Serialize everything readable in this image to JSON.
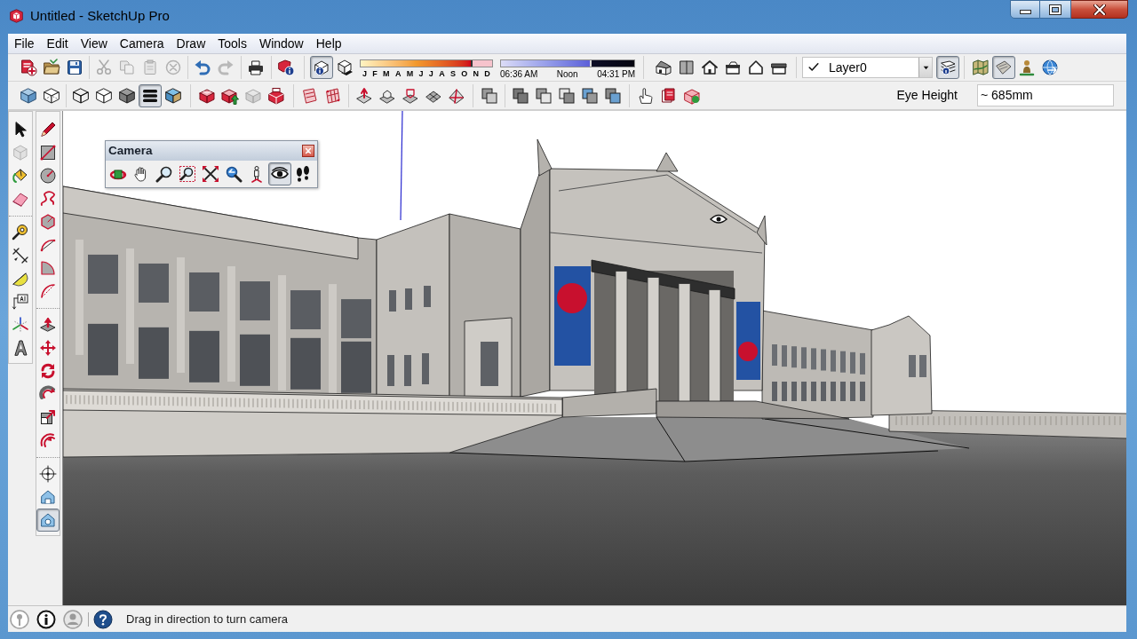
{
  "window": {
    "title": "Untitled - SketchUp Pro"
  },
  "menu_bar": [
    "File",
    "Edit",
    "View",
    "Camera",
    "Draw",
    "Tools",
    "Window",
    "Help"
  ],
  "toolbar_row_1": [
    {
      "kind": "buttons",
      "buttons": [
        {
          "selected": false,
          "disabled": false
        },
        {
          "selected": false,
          "disabled": false
        },
        {
          "selected": false,
          "disabled": false
        }
      ]
    },
    {
      "kind": "buttons",
      "buttons": [
        {
          "selected": false,
          "disabled": true
        },
        {
          "selected": false,
          "disabled": true
        },
        {
          "selected": false,
          "disabled": true
        },
        {
          "selected": false,
          "disabled": true
        }
      ]
    },
    {
      "kind": "buttons",
      "buttons": [
        {
          "selected": false,
          "disabled": false
        },
        {
          "selected": false,
          "disabled": true
        }
      ]
    },
    {
      "kind": "buttons",
      "buttons": [
        {
          "selected": false,
          "disabled": false
        }
      ]
    },
    {
      "kind": "buttons",
      "buttons": [
        {
          "selected": false,
          "disabled": false
        }
      ]
    },
    {
      "kind": "buttons",
      "buttons": [
        {
          "selected": true,
          "disabled": false
        },
        {
          "selected": false,
          "disabled": false
        }
      ]
    },
    {
      "kind": "month_slider",
      "labels": [
        "J",
        "F",
        "M",
        "A",
        "M",
        "J",
        "J",
        "A",
        "S",
        "O",
        "N",
        "D"
      ],
      "level": 0.85
    },
    {
      "kind": "time_slider",
      "labels": [
        "06:36 AM",
        "Noon",
        "04:31 PM"
      ],
      "level": 0.68
    },
    {
      "kind": "buttons",
      "buttons": [
        {
          "selected": false,
          "disabled": false
        },
        {
          "selected": false,
          "disabled": false
        },
        {
          "selected": false,
          "disabled": false
        },
        {
          "selected": false,
          "disabled": false
        },
        {
          "selected": false,
          "disabled": false
        },
        {
          "selected": false,
          "disabled": false
        }
      ]
    },
    {
      "kind": "layer_dropdown",
      "value": "Layer0"
    },
    {
      "kind": "buttons",
      "buttons": [
        {
          "selected": true,
          "disabled": false
        }
      ]
    },
    {
      "kind": "buttons",
      "buttons": [
        {
          "selected": false,
          "disabled": false
        },
        {
          "selected": true,
          "disabled": false
        },
        {
          "selected": false,
          "disabled": false
        },
        {
          "selected": false,
          "disabled": false
        }
      ]
    }
  ],
  "toolbar_row_2": [
    {
      "kind": "buttons",
      "buttons": [
        {
          "selected": false,
          "disabled": false
        },
        {
          "selected": false,
          "disabled": false
        }
      ]
    },
    {
      "kind": "buttons",
      "buttons": [
        {
          "selected": false,
          "disabled": false
        },
        {
          "selected": false,
          "disabled": false
        },
        {
          "selected": false,
          "disabled": false
        },
        {
          "selected": true,
          "disabled": false
        },
        {
          "selected": false,
          "disabled": false
        }
      ]
    },
    {
      "kind": "buttons",
      "buttons": [
        {
          "selected": false,
          "disabled": false
        },
        {
          "selected": false,
          "disabled": false
        },
        {
          "selected": false,
          "disabled": true
        },
        {
          "selected": false,
          "disabled": false
        }
      ]
    },
    {
      "kind": "buttons",
      "buttons": [
        {
          "selected": false,
          "disabled": false
        },
        {
          "selected": false,
          "disabled": false
        }
      ]
    },
    {
      "kind": "buttons",
      "buttons": [
        {
          "selected": false,
          "disabled": false
        },
        {
          "selected": false,
          "disabled": false
        },
        {
          "selected": false,
          "disabled": false
        },
        {
          "selected": false,
          "disabled": false
        },
        {
          "selected": false,
          "disabled": false
        }
      ]
    },
    {
      "kind": "buttons",
      "buttons": [
        {
          "selected": false,
          "disabled": false
        }
      ]
    },
    {
      "kind": "buttons",
      "buttons": [
        {
          "selected": false,
          "disabled": false
        },
        {
          "selected": false,
          "disabled": false
        },
        {
          "selected": false,
          "disabled": false
        },
        {
          "selected": false,
          "disabled": false
        },
        {
          "selected": false,
          "disabled": false
        }
      ]
    },
    {
      "kind": "buttons",
      "buttons": [
        {
          "selected": false,
          "disabled": false
        },
        {
          "selected": false,
          "disabled": false
        },
        {
          "selected": false,
          "disabled": false
        }
      ]
    },
    {
      "kind": "measurement",
      "label": "Eye Height",
      "value": "~ 685mm"
    }
  ],
  "left_toolbars": [
    [
      [
        {
          "selected": false,
          "disabled": false
        },
        {
          "selected": false,
          "disabled": true
        },
        {
          "selected": false,
          "disabled": false
        },
        {
          "selected": false,
          "disabled": false
        }
      ],
      [
        {
          "selected": false,
          "disabled": false
        },
        {
          "selected": false,
          "disabled": false
        },
        {
          "selected": false,
          "disabled": false
        },
        {
          "selected": false,
          "disabled": false
        },
        {
          "selected": false,
          "disabled": false
        },
        {
          "selected": false,
          "disabled": false
        }
      ]
    ],
    [
      [
        {
          "selected": false,
          "disabled": false
        },
        {
          "selected": false,
          "disabled": false
        },
        {
          "selected": false,
          "disabled": false
        },
        {
          "selected": false,
          "disabled": false
        },
        {
          "selected": false,
          "disabled": false
        },
        {
          "selected": false,
          "disabled": false
        },
        {
          "selected": false,
          "disabled": false
        },
        {
          "selected": false,
          "disabled": false
        }
      ],
      [
        {
          "selected": false,
          "disabled": false
        },
        {
          "selected": false,
          "disabled": false
        },
        {
          "selected": false,
          "disabled": false
        },
        {
          "selected": false,
          "disabled": false
        },
        {
          "selected": false,
          "disabled": false
        },
        {
          "selected": false,
          "disabled": false
        }
      ],
      [
        {
          "selected": false,
          "disabled": false
        },
        {
          "selected": false,
          "disabled": false
        },
        {
          "selected": true,
          "disabled": false
        }
      ]
    ]
  ],
  "camera_toolbar": {
    "title": "Camera",
    "buttons": [
      {
        "selected": false
      },
      {
        "selected": false
      },
      {
        "selected": false
      },
      {
        "selected": false
      },
      {
        "selected": false
      },
      {
        "selected": false
      },
      {
        "selected": false
      },
      {
        "selected": true
      },
      {
        "selected": false
      }
    ]
  },
  "status_bar": {
    "message": "Drag in direction to turn camera"
  }
}
